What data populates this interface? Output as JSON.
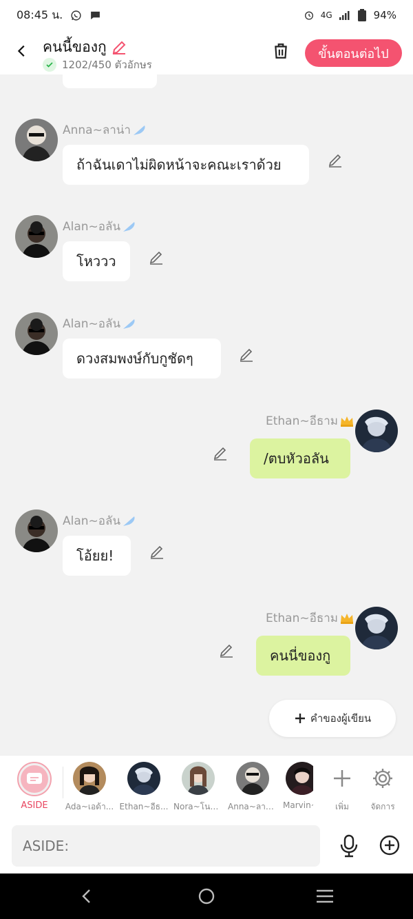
{
  "status": {
    "time": "08:45 น.",
    "network": "4G",
    "battery": "94%"
  },
  "header": {
    "title": "คนนี้ของกู",
    "char_count": "1202/450 ตัวอักษร",
    "next_label": "ขั้นตอนต่อไป"
  },
  "messages": [
    {
      "name": "Anna~ลาน่า",
      "text": "ถ้าฉันเดาไม่ผิดหน้าจะคณะเราด้วย"
    },
    {
      "name": "Alan~อลัน",
      "text": "โหววว"
    },
    {
      "name": "Alan~อลัน",
      "text": "ดวงสมพงษ์กับกูชัดๆ"
    },
    {
      "name": "Ethan~อีธาม",
      "text": "/ตบหัวอลัน"
    },
    {
      "name": "Alan~อลัน",
      "text": "โอ้ยย!"
    },
    {
      "name": "Ethan~อีธาม",
      "text": "คนนี่ของกู"
    }
  ],
  "author_button": "คำของผู้เขียน",
  "characters": [
    {
      "label": "ASIDE"
    },
    {
      "label": "Ada~เอด้า..."
    },
    {
      "label": "Ethan~อีธ..."
    },
    {
      "label": "Nora~โนล่..."
    },
    {
      "label": "Anna~ลาน่..."
    },
    {
      "label": "Marvin~"
    }
  ],
  "char_actions": {
    "add": "เพิ่ม",
    "manage": "จัดการ"
  },
  "input": {
    "placeholder": "ASIDE:"
  },
  "colors": {
    "accent": "#f45370",
    "my_bubble": "#dcf3a0",
    "aside_label": "#e8455f"
  }
}
